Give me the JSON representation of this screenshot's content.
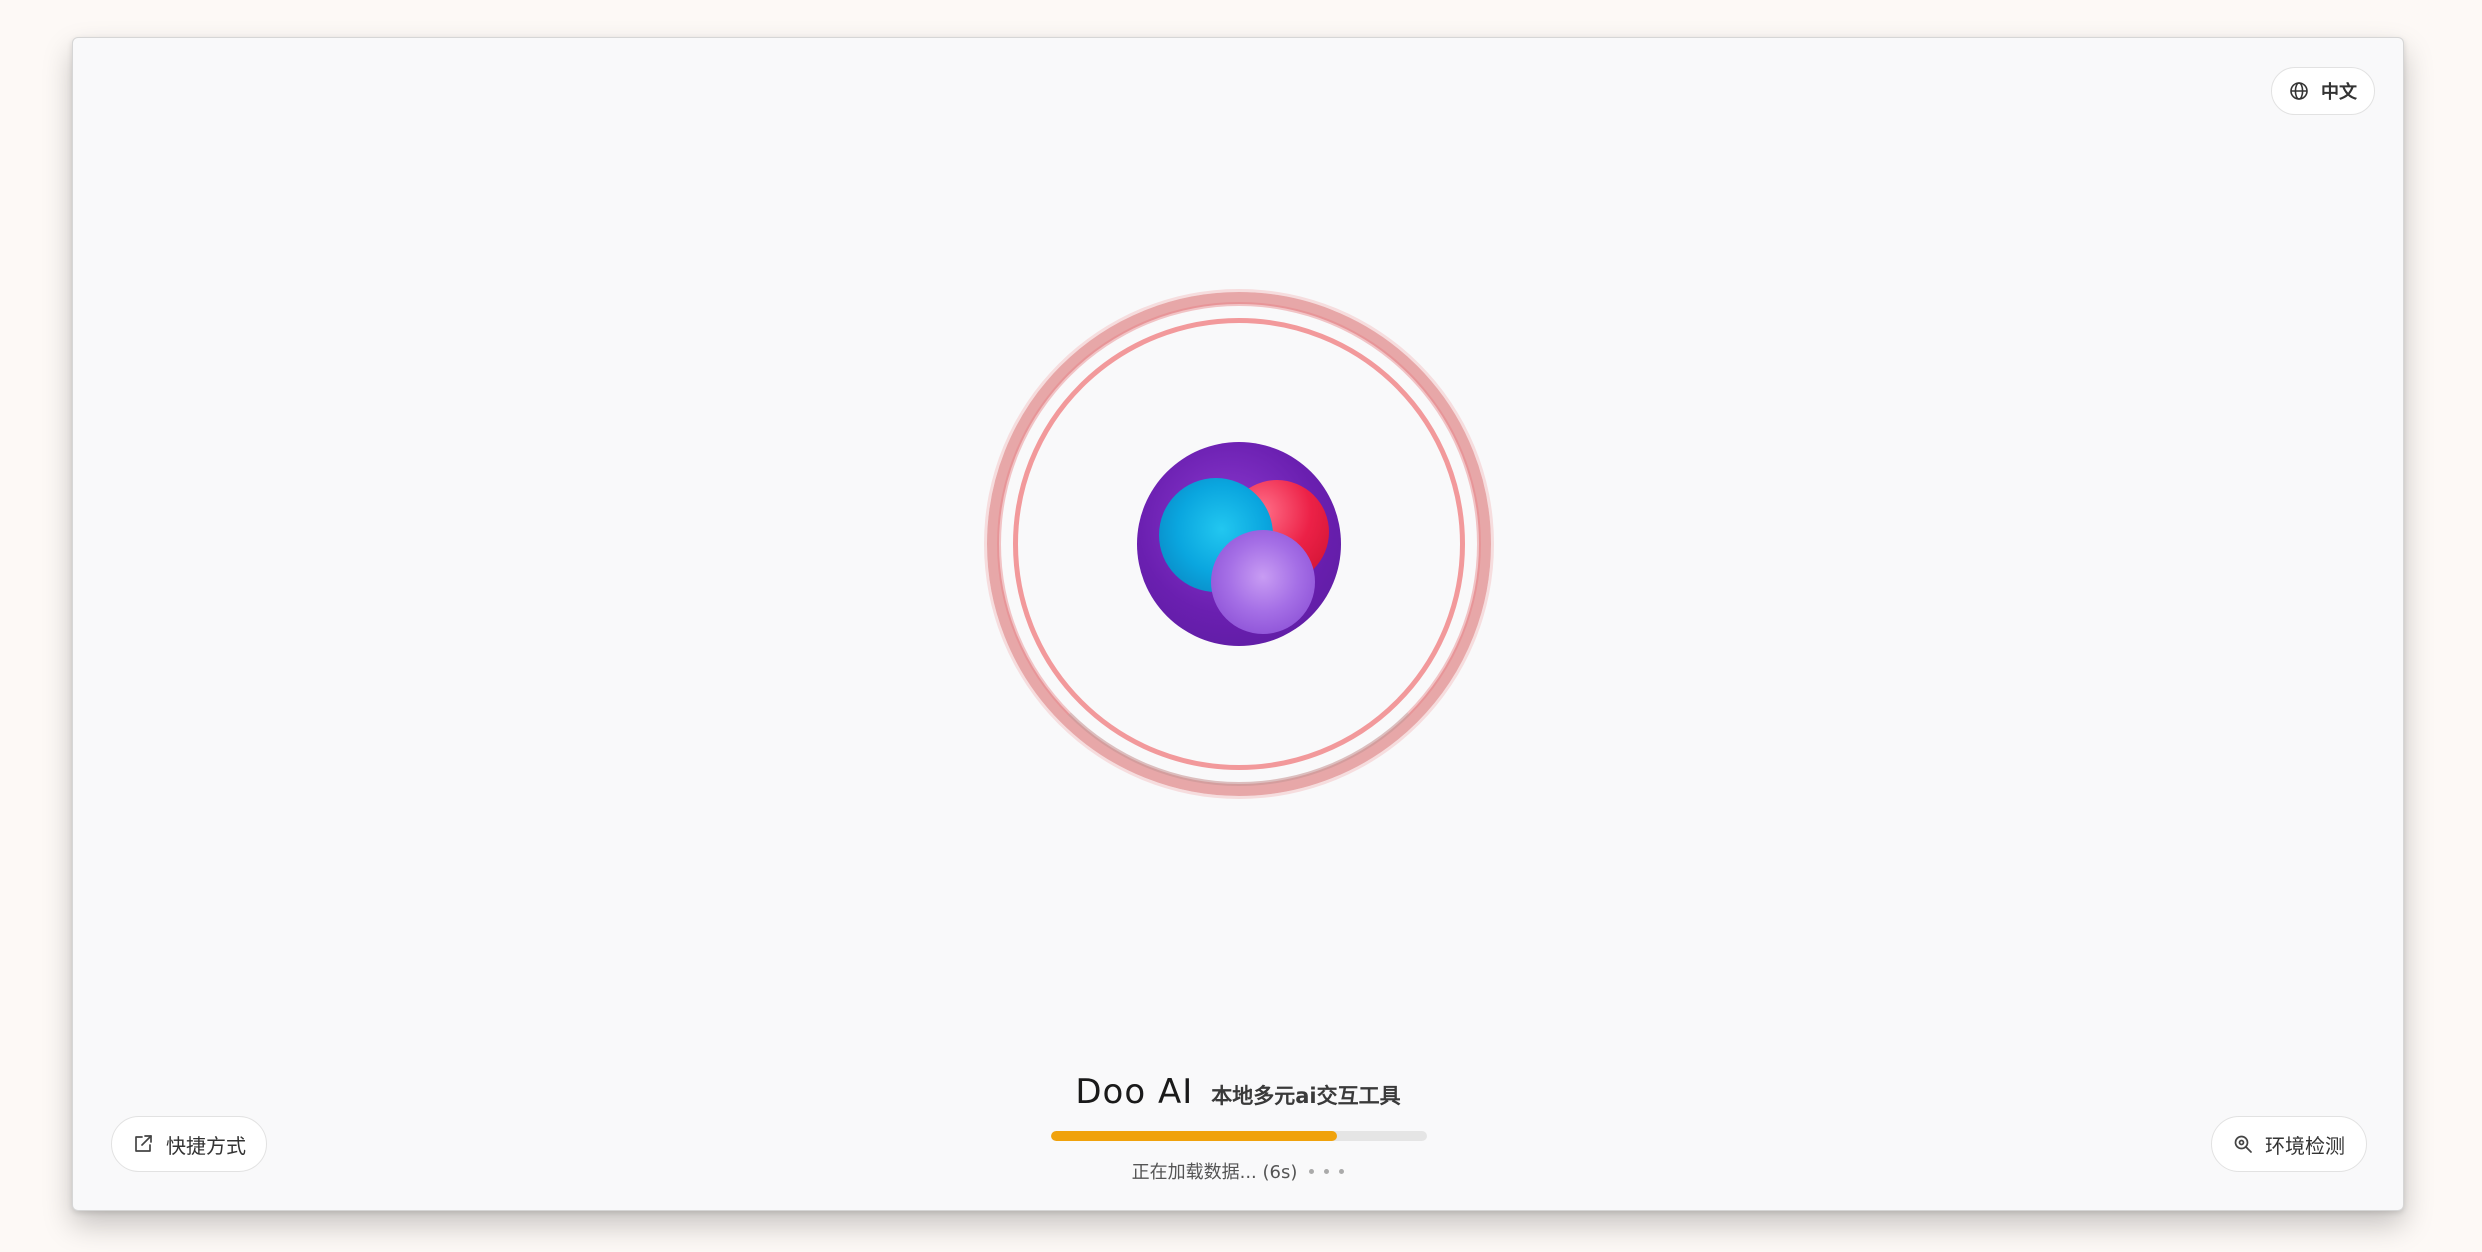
{
  "language_button": {
    "label": "中文",
    "icon": "globe-icon"
  },
  "brand": {
    "name": "Doo AI",
    "tagline": "本地多元ai交互工具"
  },
  "progress": {
    "value": 0.76,
    "color": "#f0a20c"
  },
  "status": {
    "loading_text": "正在加载数据... (6s)"
  },
  "shortcut_button": {
    "label": "快捷方式",
    "icon": "external-link-icon"
  },
  "env_button": {
    "label": "环境检测",
    "icon": "zoom-search-icon"
  }
}
